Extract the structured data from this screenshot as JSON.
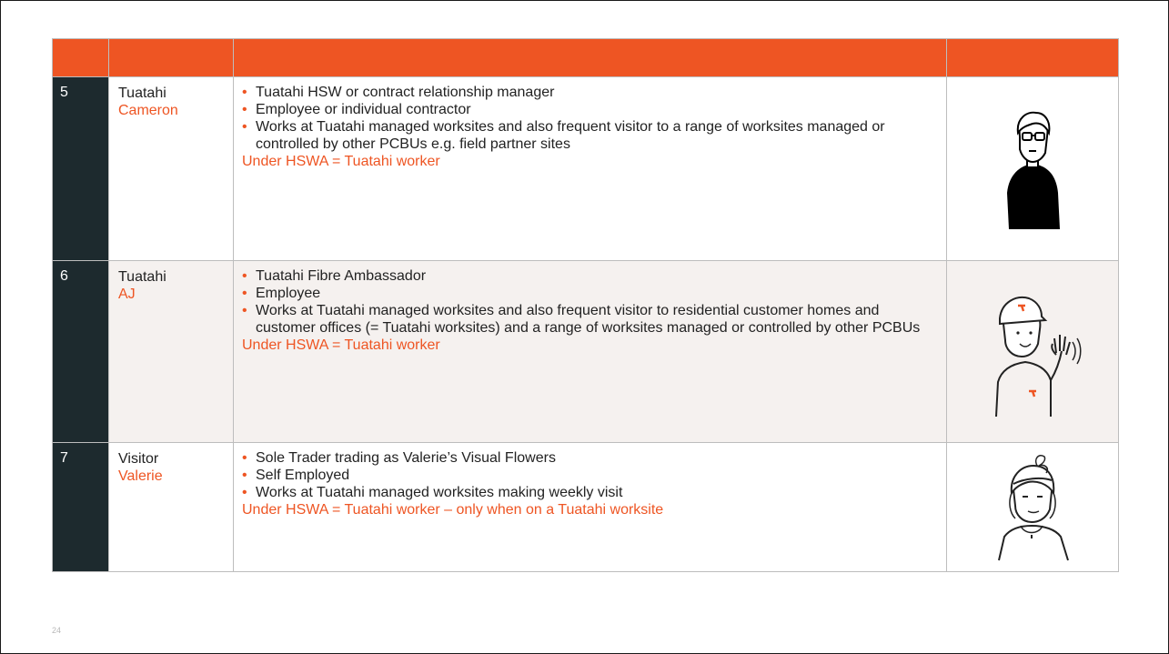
{
  "colors": {
    "accent": "#ee5523",
    "dark_column": "#1d2a2e",
    "highlight_row": "#f5f1ef"
  },
  "table": {
    "headers": [
      "",
      "",
      "",
      ""
    ],
    "rows": [
      {
        "number": "5",
        "role": "Tuatahi",
        "name": "Cameron",
        "bullets": [
          "Tuatahi HSW or contract relationship manager",
          "Employee or individual contractor",
          "Works at Tuatahi managed worksites and also frequent visitor to a range of worksites managed or controlled by other PCBUs e.g. field partner sites"
        ],
        "status": "Under HSWA = Tuatahi worker",
        "illustration": "man-with-glasses-illustration"
      },
      {
        "number": "6",
        "role": "Tuatahi",
        "name": "AJ",
        "bullets": [
          "Tuatahi Fibre Ambassador",
          "Employee",
          "Works at Tuatahi managed worksites and also frequent visitor to residential customer homes and customer offices (= Tuatahi worksites) and a range of worksites managed or controlled by other PCBUs"
        ],
        "status": "Under HSWA = Tuatahi worker",
        "illustration": "waving-man-with-cap-illustration"
      },
      {
        "number": "7",
        "role": "Visitor",
        "name": "Valerie",
        "bullets": [
          "Sole Trader trading as Valerie’s Visual Flowers",
          "Self Employed",
          "Works at Tuatahi managed worksites making weekly visit"
        ],
        "status": "Under HSWA = Tuatahi worker – only when on a Tuatahi worksite",
        "illustration": "woman-with-headband-illustration"
      }
    ]
  },
  "bullet_glyph": "•",
  "page_number": "24"
}
